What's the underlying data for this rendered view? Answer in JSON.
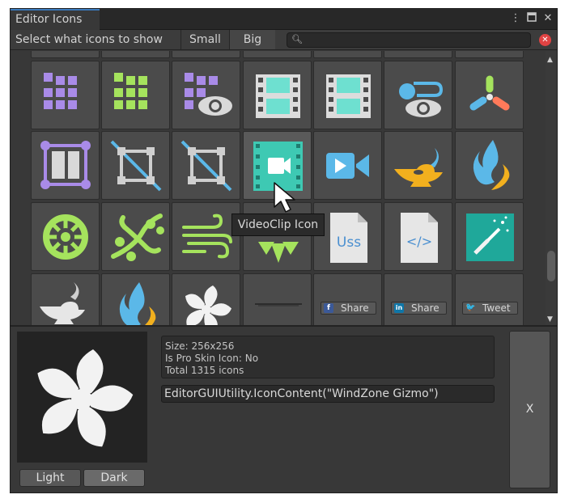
{
  "window": {
    "tab_title": "Editor Icons",
    "menu_icon": "kebab-menu-icon",
    "maximize_icon": "maximize-icon",
    "close_icon": "close-icon"
  },
  "toolbar": {
    "label": "Select what icons to show",
    "small_label": "Small",
    "big_label": "Big",
    "selected_size": "Big",
    "search_placeholder": "",
    "search_value": ""
  },
  "grid": {
    "icons": [
      {
        "icon": "purple-grid-icon"
      },
      {
        "icon": "green-grid-icon"
      },
      {
        "icon": "purple-grid-eye-icon"
      },
      {
        "icon": "filmstrip-icon"
      },
      {
        "icon": "filmstrip-icon"
      },
      {
        "icon": "visual-effect-eye-icon"
      },
      {
        "icon": "particle-system-icon"
      },
      {
        "icon": "purple-layout-frame-icon"
      },
      {
        "icon": "rect-transform-gray-icon"
      },
      {
        "icon": "rect-transform-gray-icon"
      },
      {
        "icon": "videoclip-icon"
      },
      {
        "icon": "video-player-icon"
      },
      {
        "icon": "magic-lamp-icon"
      },
      {
        "icon": "flame-icon"
      },
      {
        "icon": "green-wheel-icon"
      },
      {
        "icon": "green-vine-icon"
      },
      {
        "icon": "wind-icon"
      },
      {
        "icon": "green-triangles-icon"
      },
      {
        "icon": "uss-file-icon",
        "text": "Uss"
      },
      {
        "icon": "uxml-file-icon",
        "text": "</>"
      },
      {
        "icon": "magic-wand-icon"
      },
      {
        "icon": "lamp-icon"
      },
      {
        "icon": "flame-icon"
      },
      {
        "icon": "windzone-fan-icon"
      },
      {
        "icon": "shadow-line-icon"
      }
    ],
    "share_buttons": [
      {
        "label": "Share",
        "icon": "facebook-icon",
        "glyph": "f",
        "color": "#3b5998"
      },
      {
        "label": "Share",
        "icon": "linkedin-icon",
        "glyph": "in",
        "color": "#0e76a8"
      },
      {
        "label": "Tweet",
        "icon": "twitter-icon",
        "glyph": "🐦",
        "color": "#1da1f2"
      }
    ],
    "tooltip": "VideoClip Icon"
  },
  "details": {
    "size_line": "Size: 256x256",
    "pro_skin_line": "Is Pro Skin Icon: No",
    "total_line": "Total 1315 icons",
    "code": "EditorGUIUtility.IconContent(\"WindZone Gizmo\")",
    "preview_icon": "windzone-fan-icon",
    "light_label": "Light",
    "dark_label": "Dark",
    "close_label": "X"
  }
}
